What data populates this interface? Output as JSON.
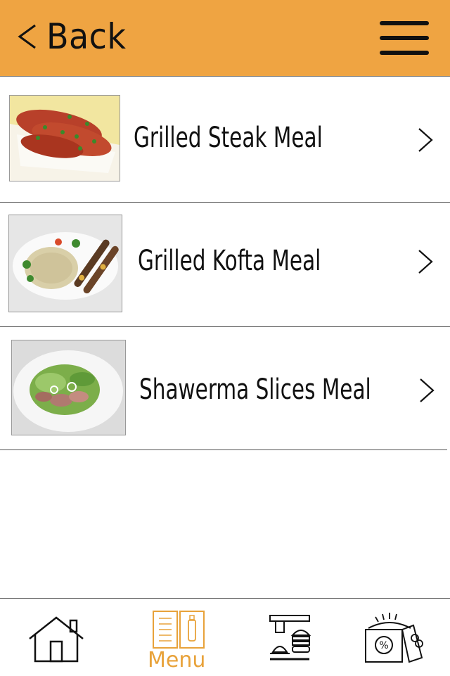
{
  "header": {
    "back_label": "Back",
    "back_icon": "chevron-left-icon",
    "menu_icon": "hamburger-icon",
    "background_color": "#efa442"
  },
  "meals": [
    {
      "name": "Grilled Steak Meal",
      "image": "grilled-steak-photo"
    },
    {
      "name": "Grilled Kofta Meal",
      "image": "grilled-kofta-photo"
    },
    {
      "name": "Shawerma Slices Meal",
      "image": "shawerma-slices-photo"
    }
  ],
  "tabbar": {
    "tabs": [
      {
        "id": "home",
        "icon": "house-icon",
        "label": ""
      },
      {
        "id": "menu",
        "icon": "menu-book-icon",
        "label": "Menu",
        "active": true
      },
      {
        "id": "orders",
        "icon": "burger-service-icon",
        "label": ""
      },
      {
        "id": "offers",
        "icon": "discount-gift-icon",
        "label": ""
      }
    ],
    "active_color": "#e8a23a"
  }
}
